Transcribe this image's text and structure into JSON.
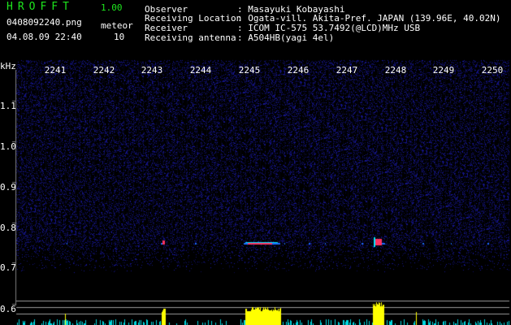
{
  "header": {
    "app_name": "HROFFT",
    "version": "1.00",
    "filename": "0408092240.png",
    "datetime": "04.08.09 22:40",
    "meteor_label": "meteor",
    "meteor_count": "10"
  },
  "info": {
    "observer_label": "Observer",
    "observer_value": ": Masayuki Kobayashi",
    "location_label": "Receiving Location",
    "location_value": ": Ogata-vill. Akita-Pref. JAPAN (139.96E, 40.02N)",
    "receiver_label": "Receiver",
    "receiver_value": ": ICOM IC-575 53.7492(@LCD)MHz USB",
    "antenna_label": "Receiving antenna",
    "antenna_value": ": A504HB(yagi 4el)"
  },
  "axis": {
    "y_unit": "kHz",
    "x_ticks": [
      "2241",
      "2242",
      "2243",
      "2244",
      "2245",
      "2246",
      "2247",
      "2248",
      "2249",
      "2250"
    ],
    "y_ticks": [
      "1.1",
      "1.0",
      "0.9",
      "0.8",
      "0.7",
      "0.6"
    ]
  },
  "colors": {
    "title_green": "#1ee61e",
    "noise_blue": "#1a1a9e",
    "echo_yellow": "#ffff00",
    "echo_cyan": "#00e5ff"
  }
}
